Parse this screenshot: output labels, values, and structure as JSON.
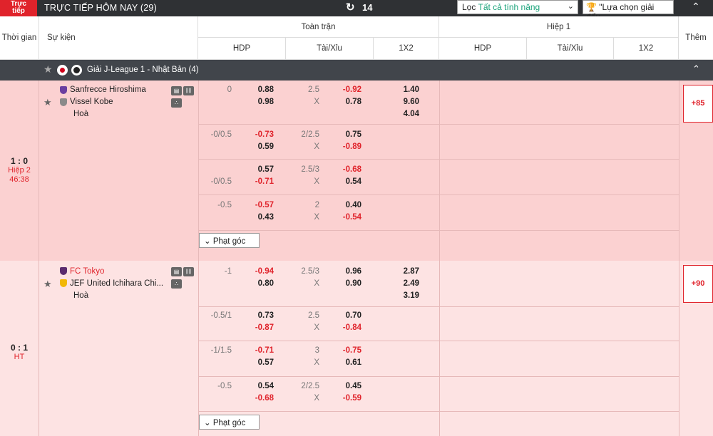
{
  "topbar": {
    "live_badge_line1": "Trực",
    "live_badge_line2": "tiếp",
    "title": "TRỰC TIẾP HÔM NAY (29)",
    "refresh_icon": "refresh-icon",
    "refresh_count": "14",
    "filter_label": "Lọc",
    "filter_value": "Tất cả tính năng",
    "league_select_label": "\"Lựa chọn giải đấu",
    "collapse_icon": "double-chevron-up-icon"
  },
  "header": {
    "time": "Thời gian",
    "event": "Sự kiện",
    "full_match": "Toàn trận",
    "half1": "Hiệp 1",
    "more": "Thêm",
    "hdp": "HDP",
    "ou": "Tài/Xỉu",
    "x12": "1X2"
  },
  "league": {
    "name": "Giải J-League 1 - Nhật Bản (4)"
  },
  "matches": [
    {
      "score": "1 : 0",
      "period": "Hiệp 2",
      "clock": "46:38",
      "home": "Sanfrecce Hiroshima",
      "away": "Vissel Kobe",
      "draw": "Hoà",
      "more": "+85",
      "corner_label": "Phạt góc",
      "rows": [
        {
          "hdp": "0",
          "hdp_h": "0.88",
          "hdp_a": "0.98",
          "ou": "2.5",
          "ou_x": "X",
          "ou_o": "-0.92",
          "ou_u": "0.78",
          "x1": "1.40",
          "x2": "9.60",
          "xd": "4.04"
        },
        {
          "hdp": "-0/0.5",
          "hdp_h": "-0.73",
          "hdp_a": "0.59",
          "ou": "2/2.5",
          "ou_x": "X",
          "ou_o": "0.75",
          "ou_u": "-0.89"
        },
        {
          "hdp": "-0/0.5",
          "hdp_h": "0.57",
          "hdp_a": "-0.71",
          "ou": "2.5/3",
          "ou_x": "X",
          "ou_o": "-0.68",
          "ou_u": "0.54"
        },
        {
          "hdp": "-0.5",
          "hdp_h": "-0.57",
          "hdp_a": "0.43",
          "ou": "2",
          "ou_x": "X",
          "ou_o": "0.40",
          "ou_u": "-0.54"
        }
      ]
    },
    {
      "score": "0 : 1",
      "period": "HT",
      "home": "FC Tokyo",
      "away": "JEF United Ichihara Chi...",
      "draw": "Hoà",
      "more": "+90",
      "corner_label": "Phạt góc",
      "rows": [
        {
          "hdp": "-1",
          "hdp_h": "-0.94",
          "hdp_a": "0.80",
          "ou": "2.5/3",
          "ou_x": "X",
          "ou_o": "0.96",
          "ou_u": "0.90",
          "x1": "2.87",
          "x2": "2.49",
          "xd": "3.19"
        },
        {
          "hdp": "-0.5/1",
          "hdp_h": "0.73",
          "hdp_a": "-0.87",
          "ou": "2.5",
          "ou_x": "X",
          "ou_o": "0.70",
          "ou_u": "-0.84"
        },
        {
          "hdp": "-1/1.5",
          "hdp_h": "-0.71",
          "hdp_a": "0.57",
          "ou": "3",
          "ou_x": "X",
          "ou_o": "-0.75",
          "ou_u": "0.61"
        },
        {
          "hdp": "-0.5",
          "hdp_h": "0.54",
          "hdp_a": "-0.68",
          "ou": "2/2.5",
          "ou_x": "X",
          "ou_o": "0.45",
          "ou_u": "-0.59"
        }
      ]
    }
  ],
  "colors": {
    "accent": "#e0232b",
    "topbar": "#2f3134",
    "league_bar": "#41454b",
    "live_row": "#fbd1d1",
    "ht_row": "#fde3e3",
    "filter_value": "#1aa37a"
  }
}
